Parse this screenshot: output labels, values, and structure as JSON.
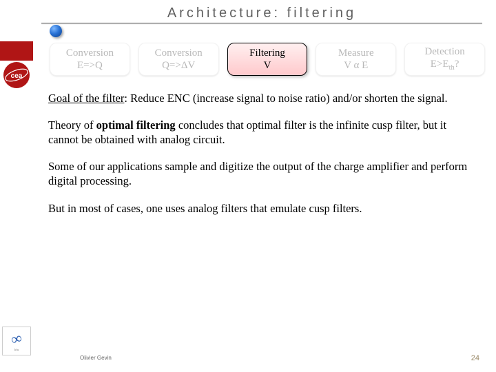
{
  "title": "Architecture: filtering",
  "stages": {
    "s1a": "Conversion",
    "s1b": "E=>Q",
    "s2a": "Conversion",
    "s2b": "Q=>ΔV",
    "s3a": "Filtering",
    "s3b": "V",
    "s4a": "Measure",
    "s4b": "V α E",
    "s5a": "Detection",
    "s5b_pre": "E>E",
    "s5b_sub": "th",
    "s5b_post": "?"
  },
  "body": {
    "goal_label": "Goal of the filter",
    "goal_rest": ": Reduce ENC (increase signal to noise ratio) and/or shorten the signal.",
    "p2_pre": "Theory of ",
    "p2_bold": "optimal filtering",
    "p2_post": " concludes that optimal filter is the infinite cusp filter, but it cannot be obtained with analog circuit.",
    "p3": "Some of our applications sample and digitize the output of the charge amplifier and perform digital processing.",
    "p4": "But in most of cases, one uses analog filters that emulate cusp filters."
  },
  "footer": {
    "author": "Olivier Gevin",
    "page": "24"
  },
  "sidebar": {
    "infinity_sub": "Irfu"
  }
}
